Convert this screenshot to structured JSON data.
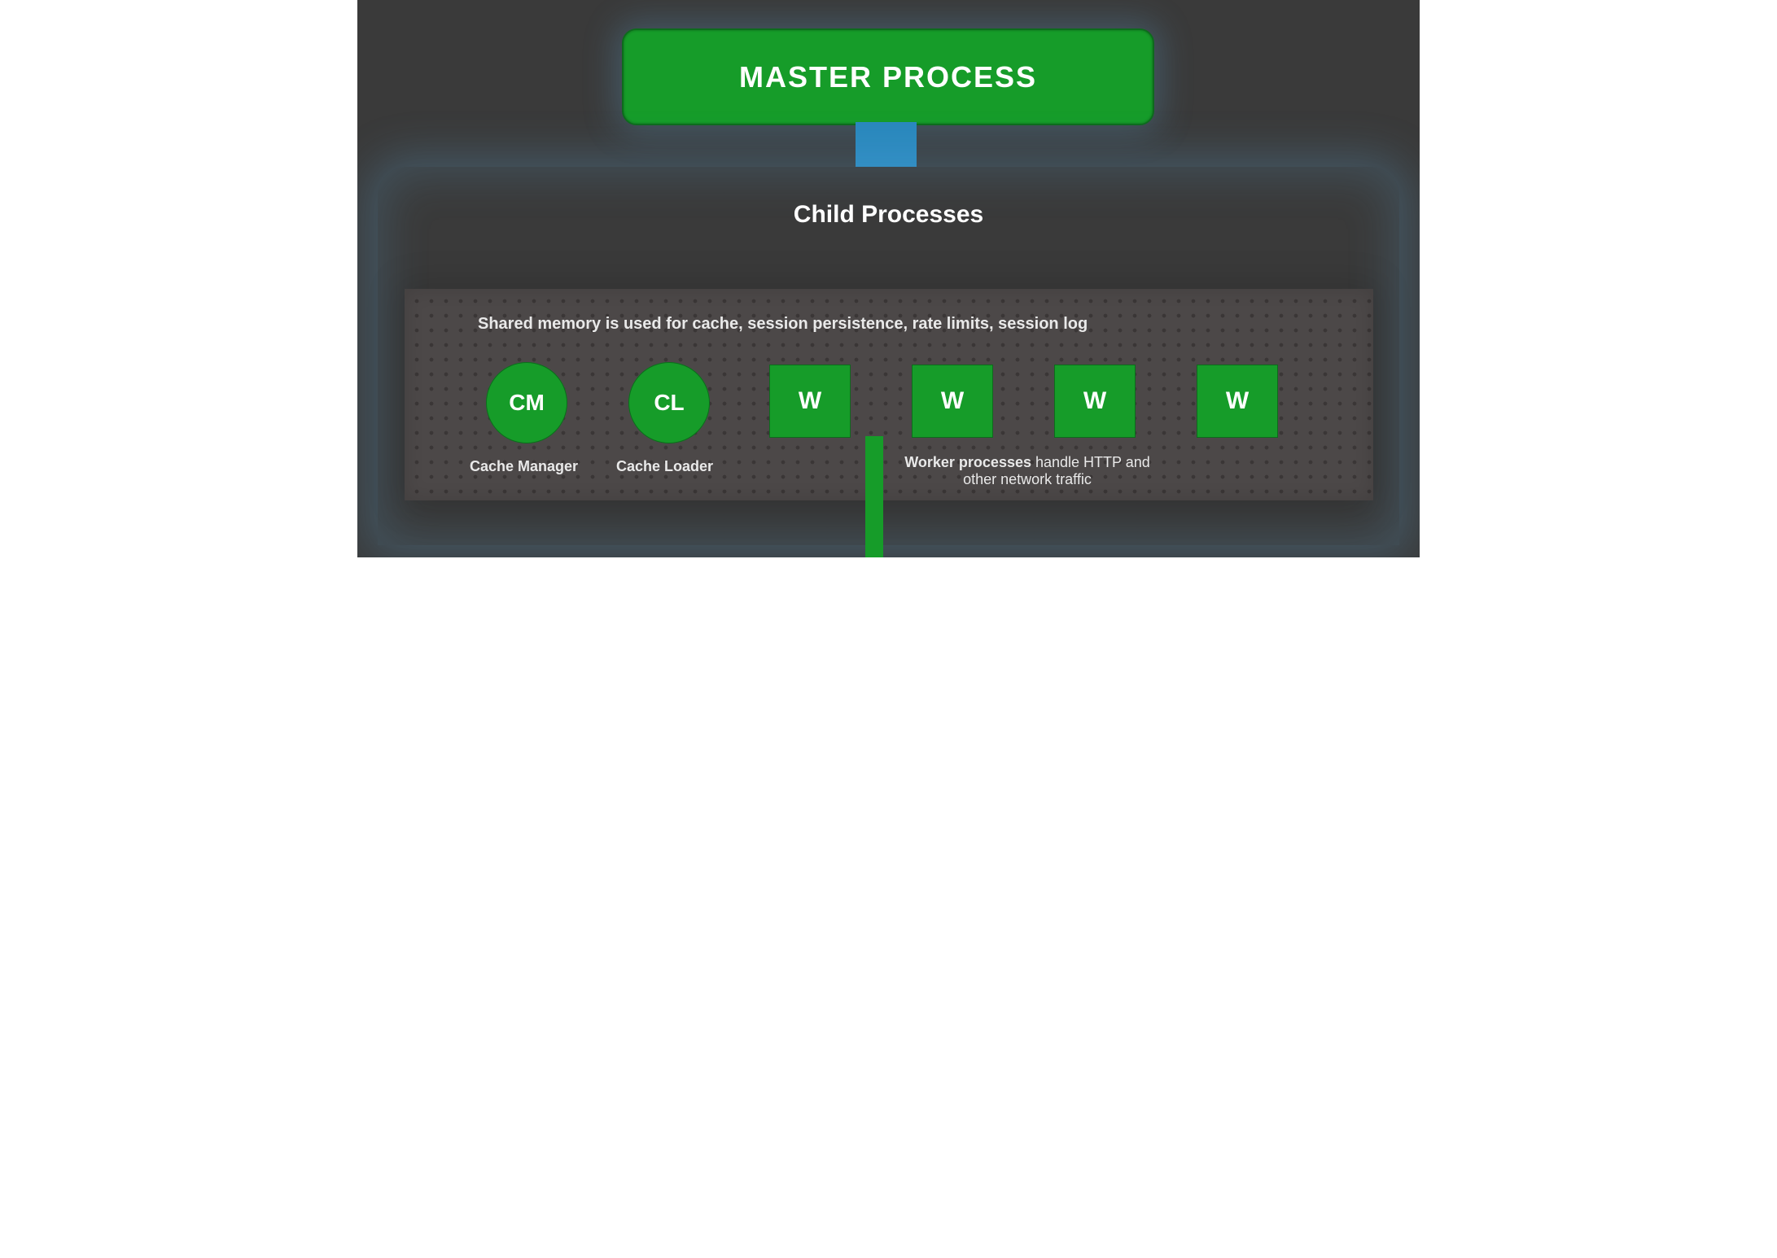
{
  "master": {
    "label": "MASTER PROCESS"
  },
  "child": {
    "title": "Child Processes"
  },
  "shared": {
    "description": "Shared memory is used for cache, session persistence, rate limits, session log"
  },
  "nodes": {
    "cm": {
      "short": "CM",
      "label": "Cache Manager"
    },
    "cl": {
      "short": "CL",
      "label": "Cache Loader"
    },
    "w1": {
      "short": "W"
    },
    "w2": {
      "short": "W"
    },
    "w3": {
      "short": "W"
    },
    "w4": {
      "short": "W"
    }
  },
  "worker_caption": {
    "bold": "Worker processes",
    "rest": " handle HTTP and other network traffic"
  },
  "colors": {
    "green": "#169c29",
    "blue": "#2a88bd",
    "bg": "#3a3a3a",
    "panel": "#4c4848"
  }
}
